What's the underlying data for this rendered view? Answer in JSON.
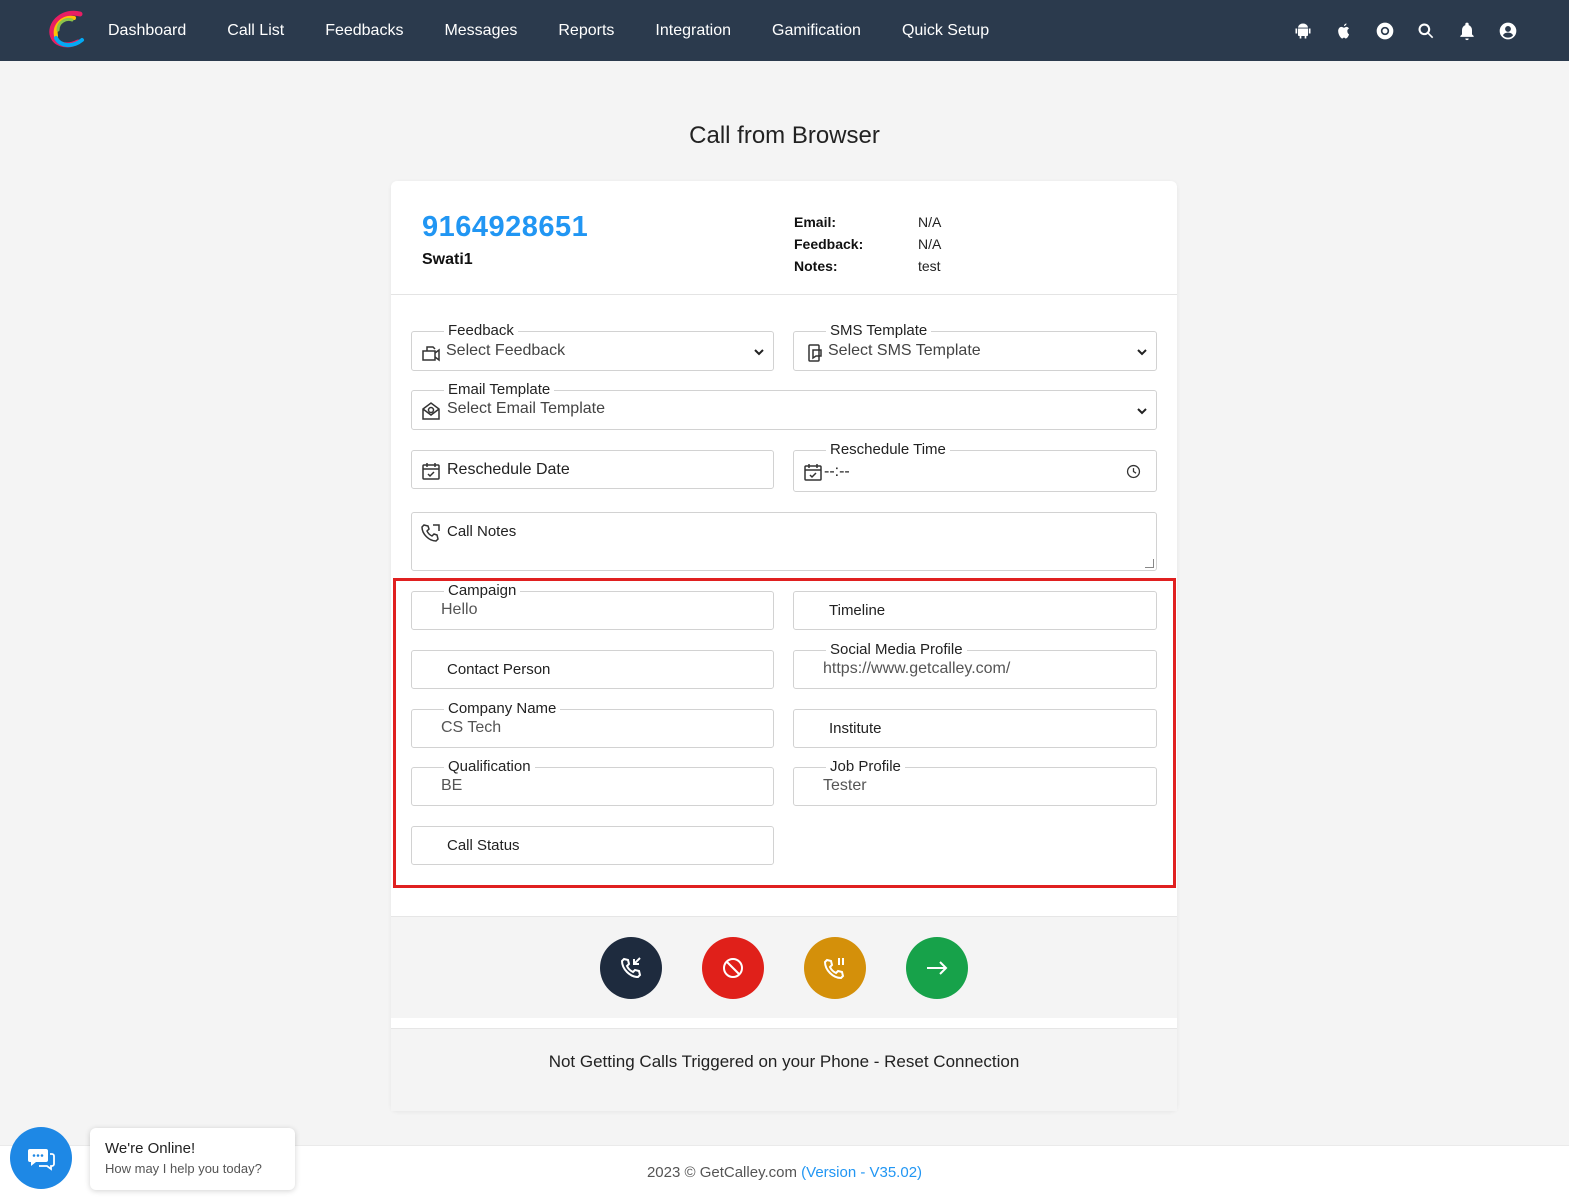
{
  "nav": {
    "items": [
      "Dashboard",
      "Call List",
      "Feedbacks",
      "Messages",
      "Reports",
      "Integration",
      "Gamification",
      "Quick Setup"
    ],
    "icons": [
      "android-icon",
      "apple-icon",
      "help-lifebuoy-icon",
      "search-icon",
      "bell-icon",
      "user-account-icon"
    ]
  },
  "page": {
    "title": "Call from Browser"
  },
  "contact": {
    "phone": "9164928651",
    "name": "Swati1",
    "email_label": "Email:",
    "email_value": "N/A",
    "feedback_label": "Feedback:",
    "feedback_value": "N/A",
    "notes_label": "Notes:",
    "notes_value": "test"
  },
  "form": {
    "feedback": {
      "label": "Feedback",
      "placeholder": "Select Feedback"
    },
    "sms": {
      "label": "SMS Template",
      "placeholder": "Select SMS Template"
    },
    "email": {
      "label": "Email Template",
      "placeholder": "Select Email Template"
    },
    "reschedule_date": {
      "placeholder": "Reschedule Date"
    },
    "reschedule_time": {
      "label": "Reschedule Time",
      "value": "--:--"
    },
    "call_notes": {
      "placeholder": "Call Notes"
    }
  },
  "custom_fields": {
    "campaign": {
      "label": "Campaign",
      "value": "Hello"
    },
    "timeline": {
      "placeholder": "Timeline"
    },
    "contact_person": {
      "placeholder": "Contact Person"
    },
    "social_media": {
      "label": "Social Media Profile",
      "value": "https://www.getcalley.com/"
    },
    "company": {
      "label": "Company Name",
      "value": "CS Tech"
    },
    "institute": {
      "placeholder": "Institute"
    },
    "qualification": {
      "label": "Qualification",
      "value": "BE"
    },
    "job_profile": {
      "label": "Job Profile",
      "value": "Tester"
    },
    "call_status": {
      "placeholder": "Call Status"
    }
  },
  "actions": {
    "colors": {
      "dial": "#1e2b3e",
      "block": "#e0201a",
      "hold": "#d4900a",
      "next": "#17a24a"
    }
  },
  "footer": {
    "reset_text": "Not Getting Calls Triggered on your Phone - Reset Connection",
    "copyright": "2023 © GetCalley.com",
    "version": "(Version - V35.02)"
  },
  "chat": {
    "title": "We're Online!",
    "subtitle": "How may I help you today?"
  }
}
